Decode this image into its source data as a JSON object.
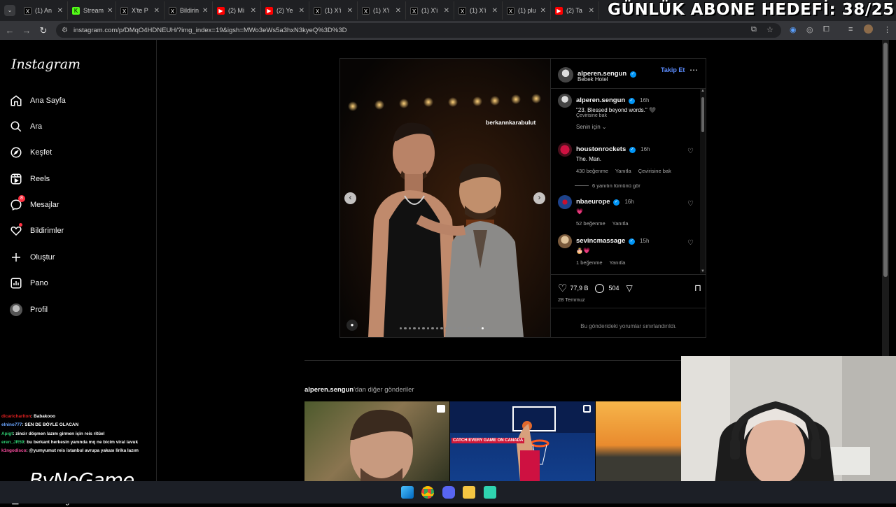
{
  "browser": {
    "tabs": [
      {
        "label": "(1) An",
        "icon": "x-logo-icon"
      },
      {
        "label": "Stream",
        "icon": "kick-logo-icon"
      },
      {
        "label": "X'te P",
        "icon": "x-logo-icon"
      },
      {
        "label": "Bildirin",
        "icon": "x-logo-icon"
      },
      {
        "label": "(2) Mi",
        "icon": "youtube-logo-icon"
      },
      {
        "label": "(2) Ye",
        "icon": "youtube-logo-icon"
      },
      {
        "label": "(1) X'i",
        "icon": "x-logo-icon"
      },
      {
        "label": "(1) X'i",
        "icon": "x-logo-icon"
      },
      {
        "label": "(1) X'i",
        "icon": "x-logo-icon"
      },
      {
        "label": "(1) X'i",
        "icon": "x-logo-icon"
      },
      {
        "label": "(1) plu",
        "icon": "x-logo-icon"
      },
      {
        "label": "(2) Ta",
        "icon": "youtube-logo-icon"
      }
    ],
    "url": "instagram.com/p/DMqO4HDNEUH/?img_index=19&igsh=MWo3eWs5a3hxN3kyeQ%3D%3D"
  },
  "overlay": {
    "goal": "GÜNLÜK ABONE HEDEFİ: 38/25",
    "brand": "ByNoGame"
  },
  "sidebar": {
    "logo": "Instagram",
    "items": [
      {
        "label": "Ana Sayfa",
        "icon": "home-icon"
      },
      {
        "label": "Ara",
        "icon": "search-icon"
      },
      {
        "label": "Keşfet",
        "icon": "compass-icon"
      },
      {
        "label": "Reels",
        "icon": "reels-icon"
      },
      {
        "label": "Mesajlar",
        "icon": "messenger-icon",
        "badge": "8"
      },
      {
        "label": "Bildirimler",
        "icon": "heart-icon"
      },
      {
        "label": "Oluştur",
        "icon": "plus-icon"
      },
      {
        "label": "Pano",
        "icon": "dashboard-icon"
      },
      {
        "label": "Profil",
        "icon": "avatar"
      }
    ],
    "meta_products": "Meta'nın diğer ürünleri"
  },
  "post": {
    "author": "alperen.sengun",
    "location": "Bebek Hotel",
    "follow": "Takip Et",
    "photo_tag": "berkannkarabulut",
    "caption": {
      "user": "alperen.sengun",
      "time": "16h",
      "text": "\"23. Blessed beyond words.\" 🖤",
      "translate": "Çevirisine bak"
    },
    "sort_label": "Senin için",
    "comments": [
      {
        "user": "houstonrockets",
        "time": "16h",
        "text": "The. Man.",
        "likes": "430 beğenme",
        "reply": "Yanıtla",
        "translate": "Çevirisine bak",
        "view_replies": "6 yanıtın tümünü gör"
      },
      {
        "user": "nbaeurope",
        "time": "16h",
        "text": "💗",
        "likes": "52 beğenme",
        "reply": "Yanıtla"
      },
      {
        "user": "sevincmassage",
        "time": "15h",
        "text": "🎂💗",
        "likes": "1 beğenme",
        "reply": "Yanıtla"
      }
    ],
    "like_count": "77,9 B",
    "comment_count": "504",
    "date": "28 Temmuz",
    "comments_limited": "Bu gönderideki yorumlar sınırlandırıldı.",
    "carousel": {
      "total": 20,
      "active": 19
    }
  },
  "more_posts": {
    "user": "alperen.sengun",
    "suffix": "'dan diğer gönderiler",
    "banner_text": "CATCH EVERY GAME ON CANADA"
  },
  "chat": [
    {
      "user": "dicaricharlton",
      "text": ": Babakooo",
      "color": "#e02020"
    },
    {
      "user": "elnino777",
      "text": ": SEN DE BÖYLE OLACAN",
      "color": "#6aa5ff"
    },
    {
      "user": "Apigt",
      "text": ": zincir döşmen lazım girmen için reis ritüel",
      "color": "#2ecc71"
    },
    {
      "user": "eren_JR59",
      "text": ": bu berkant herkesin yanında mq ne bicim viral lavuk",
      "color": "#2ecc71"
    },
    {
      "user": "k1ngodisco",
      "text": ": @yumyumut reis istanbul avrupa yakası lirika lazım",
      "color": "#ff4fa3"
    }
  ],
  "colors": {
    "verified": "#0095f6",
    "notification": "#ff3040",
    "follow": "#0095f6"
  }
}
